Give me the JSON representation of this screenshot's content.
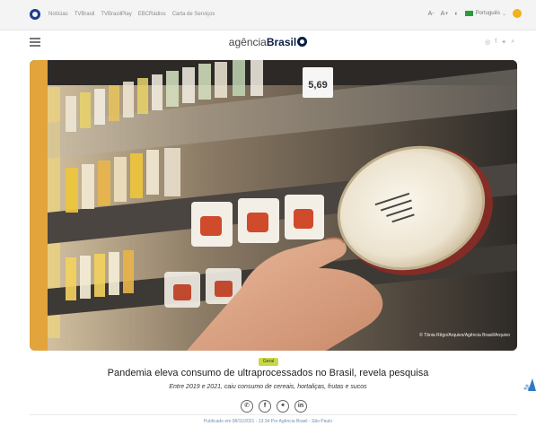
{
  "topbar": {
    "links": [
      "Notícias",
      "TVBrasil",
      "TVBrasilPlay",
      "EBCRádios",
      "Carta de Serviços"
    ],
    "font_smaller": "A-",
    "font_larger": "A+",
    "contrast": "◐",
    "language": "Português"
  },
  "header": {
    "brand_light": "agência",
    "brand_bold": "Brasil"
  },
  "photo": {
    "price_tag": "5,69",
    "credit": "© Tânia Rêgo/Arquivo/Agência Brasil/Arquivo"
  },
  "article": {
    "tag": "Geral",
    "headline": "Pandemia eleva consumo de ultraprocessados no Brasil, revela pesquisa",
    "subtitle": "Entre 2019 e 2021, caiu consumo de cereais, hortaliças, frutas e sucos",
    "share": [
      "whatsapp-icon",
      "facebook-icon",
      "twitter-icon",
      "linkedin-icon"
    ],
    "published": "Publicado em 08/11/2021 - 13:34 Por Agência Brasil - São Paulo"
  },
  "colors": {
    "brand_navy": "#0a1f44",
    "tag_green": "#c8d84a",
    "widget_blue": "#2f78c9"
  }
}
